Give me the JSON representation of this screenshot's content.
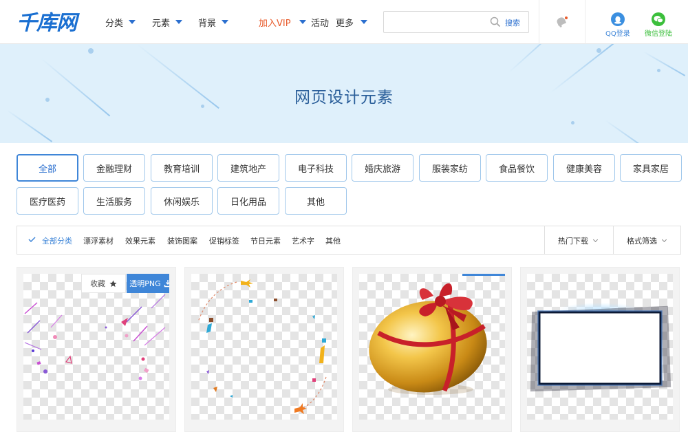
{
  "header": {
    "logo": "千库网",
    "nav": [
      {
        "label": "分类",
        "dropdown": true
      },
      {
        "label": "元素",
        "dropdown": true
      },
      {
        "label": "背景",
        "dropdown": true
      },
      {
        "label": "加入VIP",
        "dropdown": true,
        "highlight": true
      },
      {
        "label": "活动",
        "dropdown": false
      },
      {
        "label": "更多",
        "dropdown": true
      }
    ],
    "search": {
      "placeholder": "",
      "button": "搜索"
    },
    "qq_login": "QQ登录",
    "wechat_login": "微信登陆"
  },
  "banner": {
    "title": "网页设计元素"
  },
  "categories": [
    {
      "label": "全部",
      "active": true
    },
    {
      "label": "金融理财"
    },
    {
      "label": "教育培训"
    },
    {
      "label": "建筑地产"
    },
    {
      "label": "电子科技"
    },
    {
      "label": "婚庆旅游"
    },
    {
      "label": "服装家纺"
    },
    {
      "label": "食品餐饮"
    },
    {
      "label": "健康美容"
    },
    {
      "label": "家具家居"
    },
    {
      "label": "医疗医药"
    },
    {
      "label": "生活服务"
    },
    {
      "label": "休闲娱乐"
    },
    {
      "label": "日化用品"
    },
    {
      "label": "其他"
    }
  ],
  "filter": {
    "tags": [
      "全部分类",
      "漂浮素材",
      "效果元素",
      "装饰图案",
      "促销标签",
      "节日元素",
      "艺术字",
      "其他"
    ],
    "sort_hot": "热门下载",
    "sort_format": "格式筛选"
  },
  "cards": [
    {
      "image": "floating-confetti",
      "fav_label": "收藏",
      "png_label": "透明PNG"
    },
    {
      "image": "airplane-circle-frame"
    },
    {
      "image": "golden-egg-ribbon"
    },
    {
      "image": "glowing-dark-frame"
    }
  ],
  "colors": {
    "brand": "#1a6fd1",
    "accent": "#3f86d8",
    "vip": "#e85a2a",
    "banner_bg": "#dff0fb"
  }
}
